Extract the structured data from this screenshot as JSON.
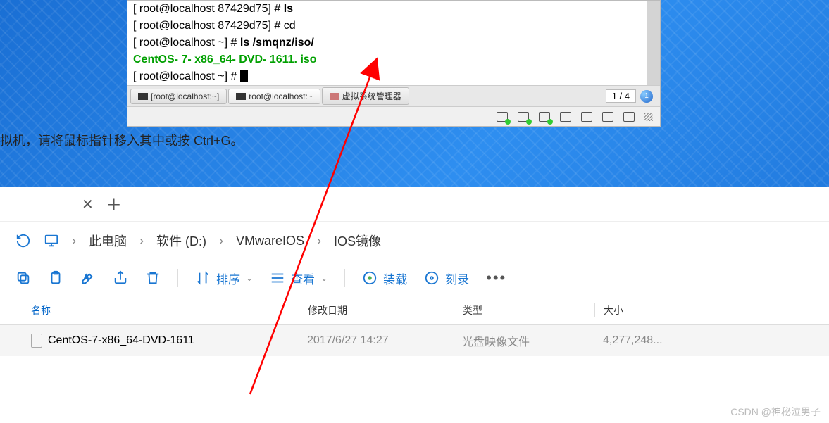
{
  "terminal": {
    "lines": [
      {
        "prompt_open": "[ ",
        "user": "root@localhost",
        "path": " 87429d75] # ",
        "cmd": "ls"
      },
      {
        "prompt_open": "[ ",
        "user": "root@localhost",
        "path": " 87429d75] # ",
        "cmd": "cd"
      },
      {
        "prompt_open": "[ ",
        "user": "root@localhost",
        "path": " ~] # ",
        "cmd": "ls /smqnz/iso/",
        "bold_cmd": true
      },
      {
        "output": "CentOS- 7- x86_64- DVD- 1611. iso"
      },
      {
        "prompt_open": "[ ",
        "user": "root@localhost",
        "path": " ~] # ",
        "cmd": "",
        "cursor": true
      }
    ],
    "tabs": [
      {
        "label": "[root@localhost:~]"
      },
      {
        "label": "root@localhost:~"
      },
      {
        "label": "虚拟系统管理器",
        "vmm": true
      }
    ],
    "page_indicator": "1 / 4"
  },
  "vm_hint": "拟机，请将鼠标指针移入其中或按 Ctrl+G。",
  "explorer": {
    "breadcrumbs": [
      "此电脑",
      "软件 (D:)",
      "VMwareIOS",
      "IOS镜像"
    ],
    "toolbar": {
      "sort": "排序",
      "view": "查看",
      "mount": "装载",
      "burn": "刻录"
    },
    "columns": {
      "name": "名称",
      "date": "修改日期",
      "type": "类型",
      "size": "大小"
    },
    "row": {
      "name": "CentOS-7-x86_64-DVD-1611",
      "date": "2017/6/27 14:27",
      "type": "光盘映像文件",
      "size": "4,277,248..."
    }
  },
  "watermark": "CSDN @神秘泣男子"
}
